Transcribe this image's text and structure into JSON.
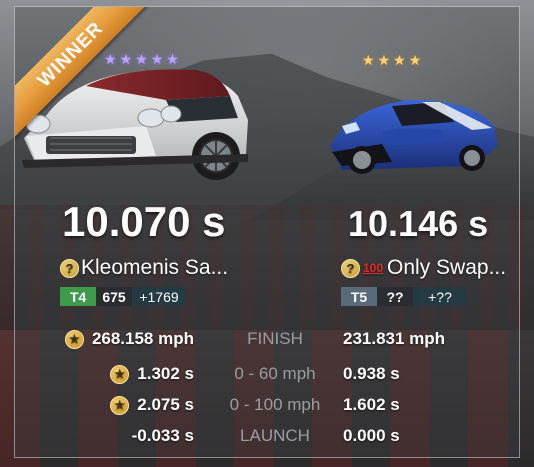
{
  "result": {
    "ribbon": "WINNER"
  },
  "left_car": {
    "stars": 5,
    "time": "10.070 s",
    "player_name": "Kleomenis Sa...",
    "tier": "T4",
    "pr": "675",
    "pr_delta": "+1769"
  },
  "right_car": {
    "stars": 4,
    "time": "10.146 s",
    "player_name": "Only Swap...",
    "badge_text": "100",
    "tier": "T5",
    "pr": "??",
    "pr_delta": "+??"
  },
  "stats": [
    {
      "label": "FINISH",
      "left": "268.158 mph",
      "right": "231.831 mph",
      "left_starred": true
    },
    {
      "label": "0 - 60 mph",
      "left": "1.302 s",
      "right": "0.938 s",
      "left_starred": true
    },
    {
      "label": "0 - 100 mph",
      "left": "2.075 s",
      "right": "1.602 s",
      "left_starred": true
    },
    {
      "label": "LAUNCH",
      "left": "-0.033 s",
      "right": "0.000 s",
      "left_starred": false
    }
  ],
  "colors": {
    "ribbon": "#e59a3b",
    "tier_t4": "#3f9a4c",
    "tier_t5": "#596a78",
    "star_left": "#b9a4ff",
    "star_right": "#ffd27a",
    "stat_label": "#9a9ea2"
  },
  "icons": {
    "help_badge": "question-mark-badge-icon",
    "hundred": "hundred-points-icon",
    "star_badge": "star-badge-icon",
    "star": "star-icon"
  }
}
